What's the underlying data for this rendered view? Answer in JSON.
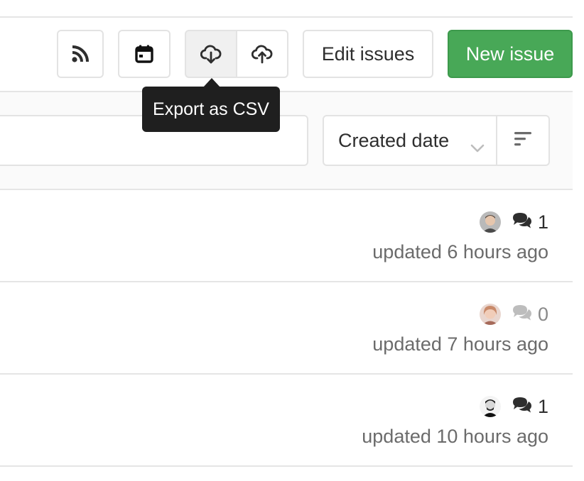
{
  "toolbar": {
    "rss_icon": "rss-icon",
    "calendar_icon": "calendar-icon",
    "export_icon": "cloud-download-icon",
    "import_icon": "cloud-upload-icon",
    "edit_label": "Edit issues",
    "new_label": "New issue",
    "new_color": "#48a857"
  },
  "tooltip": {
    "text": "Export as CSV"
  },
  "filter": {
    "search_value": "",
    "sort_label": "Created date",
    "sort_chevron_icon": "chevron-down-icon",
    "sort_direction_icon": "sort-lowest-icon"
  },
  "issues": [
    {
      "avatar": "avatar-1",
      "comment_count": "1",
      "updated": "updated 6 hours ago"
    },
    {
      "avatar": "avatar-2",
      "comment_count": "0",
      "updated": "updated 7 hours ago"
    },
    {
      "avatar": "avatar-3",
      "comment_count": "1",
      "updated": "updated 10 hours ago"
    }
  ]
}
